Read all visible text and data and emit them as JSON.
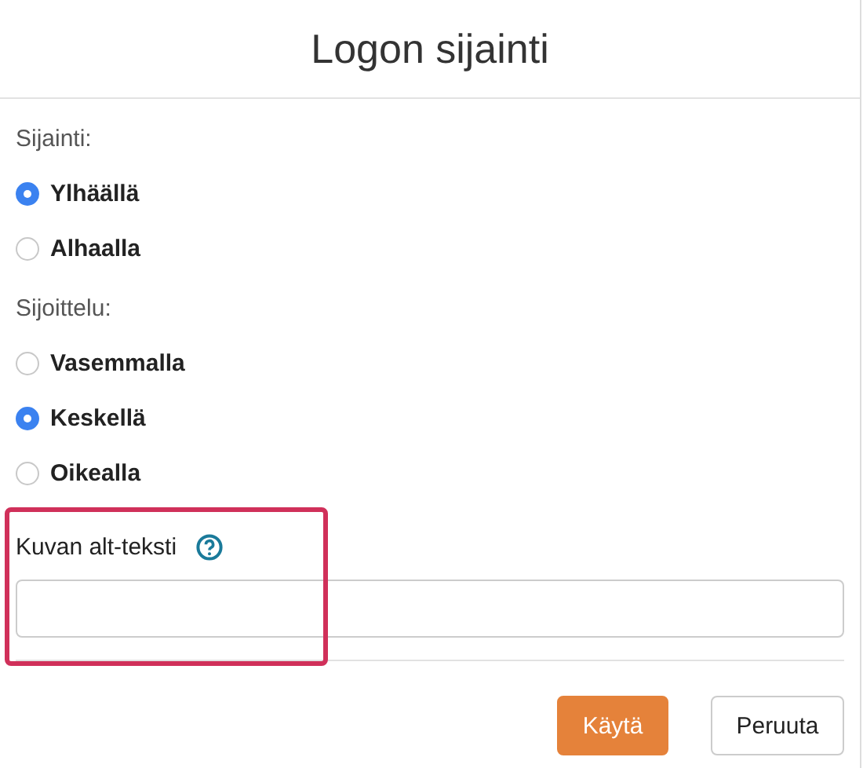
{
  "dialog": {
    "title": "Logon sijainti"
  },
  "groups": [
    {
      "label": "Sijainti:",
      "options": [
        {
          "label": "Ylhäällä",
          "selected": true
        },
        {
          "label": "Alhaalla",
          "selected": false
        }
      ]
    },
    {
      "label": "Sijoittelu:",
      "options": [
        {
          "label": "Vasemmalla",
          "selected": false
        },
        {
          "label": "Keskellä",
          "selected": true
        },
        {
          "label": "Oikealla",
          "selected": false
        }
      ]
    }
  ],
  "alt_text": {
    "label": "Kuvan alt-teksti",
    "highlighted": true
  },
  "buttons": [
    {
      "label": "Käytä",
      "kind": "primary"
    },
    {
      "label": "Peruuta",
      "kind": "secondary"
    }
  ]
}
